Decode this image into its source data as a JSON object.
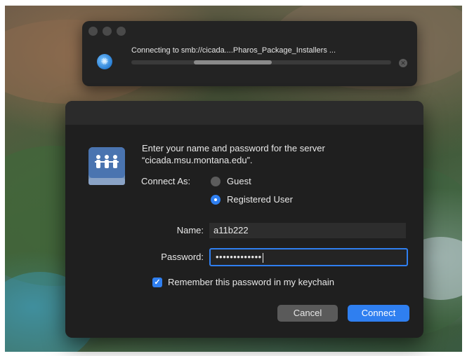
{
  "progress_window": {
    "status_text": "Connecting to smb://cicada....Pharos_Package_Installers ...",
    "progress_fraction": 0.3,
    "icon": "globe-icon",
    "stop_icon": "stop-icon"
  },
  "dialog": {
    "icon": "file-server-icon",
    "prompt_line1": "Enter your name and password for the server",
    "prompt_line2": "“cicada.msu.montana.edu”.",
    "connect_as_label": "Connect As:",
    "options": [
      "Guest",
      "Registered User"
    ],
    "selected_option": "Registered User",
    "name_label": "Name:",
    "name_value": "a11b222",
    "password_label": "Password:",
    "password_value": "•••••••••••••",
    "remember_label": "Remember this password in my keychain",
    "remember_checked": true,
    "cancel_label": "Cancel",
    "connect_label": "Connect"
  },
  "colors": {
    "accent": "#2f7ff0",
    "dialog_bg": "#1f1f1f"
  }
}
